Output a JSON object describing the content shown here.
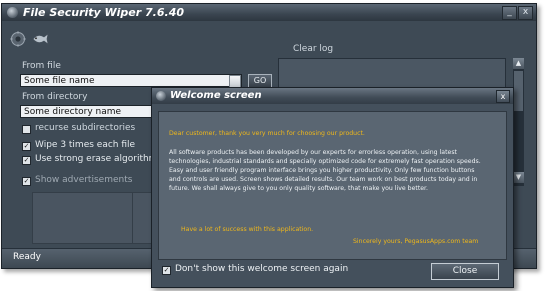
{
  "main_window": {
    "title": "File Security Wiper 7.6.40",
    "minimize_glyph": "_",
    "close_glyph": "x",
    "toolbar": {
      "icons": [
        "gear-icon",
        "fish-icon"
      ]
    },
    "clear_log_label": "Clear log",
    "from_file_label": "From file",
    "file_input_value": "Some file name",
    "go_button_label": "GO",
    "from_directory_label": "From directory",
    "directory_input_value": "Some directory name",
    "recurse_label": "recurse subdirectories",
    "recurse_checked": false,
    "wipe_label": "Wipe 3 times each file",
    "wipe_checked": true,
    "strong_label": "Use strong erase algorithm - hi",
    "strong_checked": true,
    "ads_label": "Show advertisements",
    "ads_checked": true,
    "status_text": "Ready",
    "scroll_up_glyph": "▲",
    "scroll_down_glyph": "▼"
  },
  "dialog": {
    "title": "Welcome screen",
    "close_glyph": "x",
    "greeting": "Dear customer, thank you very much for choosing our product.",
    "paragraph_lines": [
      "All software products has been developed by our experts for errorless operation, using latest",
      "technologies, industrial standards and specially optimized code for extremely fast operation speeds.",
      "Easy and user friendly program interface brings you higher productivity. Only few function buttons",
      "and controls are used. Screen shows detailed results.  Our team work on best products today and in",
      "future. We shall always give to you only quality software, that make you live better."
    ],
    "wish": "Have a lot of success with this application.",
    "signature": "Sincerely yours, PegasusApps.com team",
    "dont_show_label": "Don't show this welcome screen again",
    "dont_show_checked": true,
    "close_button_label": "Close"
  },
  "colors": {
    "window_bg": "#3e4a55",
    "accent_gold": "#f0b81a",
    "text_light": "#d0d8df"
  }
}
